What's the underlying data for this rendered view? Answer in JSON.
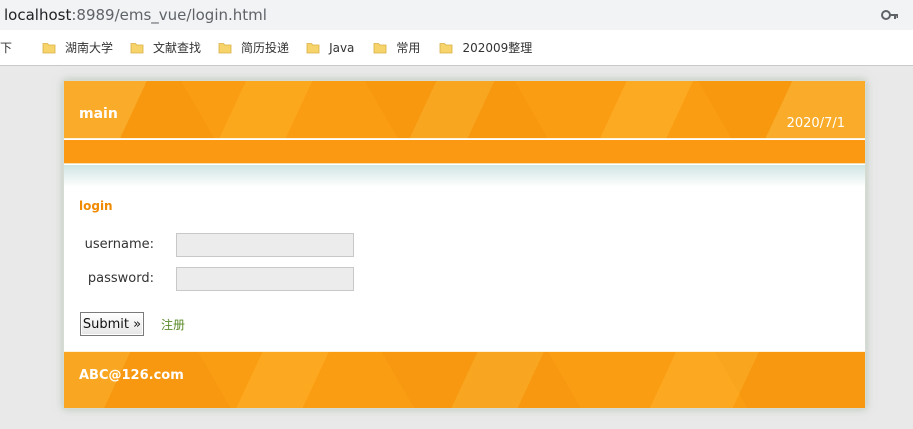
{
  "browser": {
    "url_host": "localhost",
    "url_path": ":8989/ems_vue/login.html",
    "key_icon": "key-icon"
  },
  "bookmarks": {
    "cut_label": "下",
    "items": [
      {
        "label": "湖南大学",
        "icon": "folder-icon"
      },
      {
        "label": "文献查找",
        "icon": "folder-icon"
      },
      {
        "label": "简历投递",
        "icon": "folder-icon"
      },
      {
        "label": "Java",
        "icon": "folder-icon"
      },
      {
        "label": "常用",
        "icon": "folder-icon"
      },
      {
        "label": "202009整理",
        "icon": "folder-icon"
      }
    ],
    "folder_color": "#f6d36b"
  },
  "header": {
    "title": "main",
    "date": "2020/7/1"
  },
  "login": {
    "section_title": "login",
    "username_label": "username:",
    "password_label": "password:",
    "username_value": "",
    "password_value": "",
    "submit_label": "Submit »",
    "register_label": "注册"
  },
  "footer": {
    "text": "ABC@126.com"
  },
  "colors": {
    "accent": "#fb9d13",
    "section_title": "#f08a00",
    "register_link": "#5a8a2a"
  }
}
